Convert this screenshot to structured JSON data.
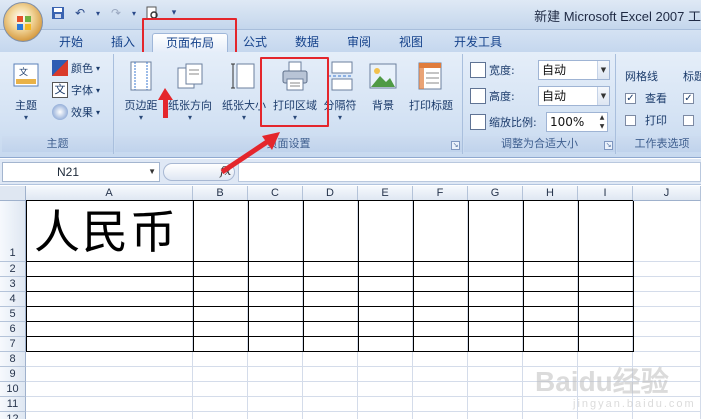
{
  "window": {
    "title": "新建 Microsoft Excel 2007 工"
  },
  "tabs": [
    {
      "label": "开始"
    },
    {
      "label": "插入"
    },
    {
      "label": "页面布局"
    },
    {
      "label": "公式"
    },
    {
      "label": "数据"
    },
    {
      "label": "审阅"
    },
    {
      "label": "视图"
    },
    {
      "label": "开发工具"
    }
  ],
  "ribbon": {
    "theme_group": {
      "label": "主题",
      "theme_button": "主题",
      "colors": "颜色",
      "fonts": "字体",
      "effects": "效果"
    },
    "page_setup_group": {
      "label": "页面设置",
      "margins": "页边距",
      "orientation": "纸张方向",
      "size": "纸张大小",
      "print_area": "打印区域",
      "breaks": "分隔符",
      "background": "背景",
      "print_titles": "打印标题"
    },
    "scale_group": {
      "label": "调整为合适大小",
      "width_label": "宽度:",
      "width_value": "自动",
      "height_label": "高度:",
      "height_value": "自动",
      "scale_label": "缩放比例:",
      "scale_value": "100%"
    },
    "sheet_options_group": {
      "label": "工作表选项",
      "gridlines": "网格线",
      "headings": "标题",
      "view": "查看",
      "print": "打印",
      "gridlines_view_checked": true,
      "gridlines_print_checked": false
    }
  },
  "formula_bar": {
    "name_box": "N21",
    "fx": "fx",
    "formula": ""
  },
  "grid": {
    "columns": [
      "A",
      "B",
      "C",
      "D",
      "E",
      "F",
      "G",
      "H",
      "I",
      "J"
    ],
    "rows": [
      "1",
      "2",
      "3",
      "4",
      "5",
      "6",
      "7",
      "8",
      "9",
      "10",
      "11",
      "12"
    ],
    "cell_A1": "人民币"
  },
  "watermark": {
    "text": "Baidu经验",
    "sub": "jingyan.baidu.com"
  },
  "colors": {
    "highlight": "#e4262c",
    "ribbon_bg": "#d5e3f4",
    "tab_text": "#15428b"
  }
}
